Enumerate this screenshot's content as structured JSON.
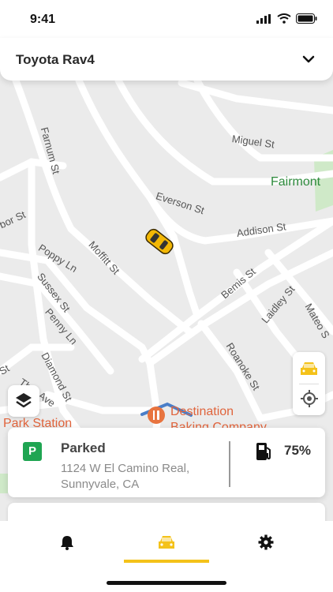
{
  "status_bar": {
    "time": "9:41"
  },
  "header": {
    "vehicle_name": "Toyota Rav4"
  },
  "map": {
    "streets": [
      {
        "label": "Farnum St"
      },
      {
        "label": "Miguel St"
      },
      {
        "label": "Everson St"
      },
      {
        "label": "Addison St"
      },
      {
        "label": "Moffitt St"
      },
      {
        "label": "Poppy Ln"
      },
      {
        "label": "Sussex St"
      },
      {
        "label": "Penny Ln"
      },
      {
        "label": "Bemis St"
      },
      {
        "label": "Laidley St"
      },
      {
        "label": "Mateo S"
      },
      {
        "label": "Roanoke St"
      },
      {
        "label": "Diamond St"
      },
      {
        "label": "Thor Ave"
      },
      {
        "label": "bor St"
      },
      {
        "label": "St"
      }
    ],
    "pois": [
      {
        "label": "Fairmont",
        "color": "#2e8b3d"
      },
      {
        "label": "Destination",
        "color": "#e0643c"
      },
      {
        "label": "Baking Company",
        "color": "#e0643c"
      },
      {
        "label": "Park Station",
        "color": "#e0643c"
      }
    ]
  },
  "status_card": {
    "badge": "P",
    "title": "Parked",
    "address": "1124 W El Camino Real, Sunnyvale, CA",
    "fuel_percent": "75%"
  },
  "tabs": [
    {
      "icon": "bell-icon",
      "active": false
    },
    {
      "icon": "car-icon",
      "active": true
    },
    {
      "icon": "gear-icon",
      "active": false
    }
  ],
  "colors": {
    "accent": "#f4c21a",
    "parked_green": "#1fa552",
    "map_bg": "#ebebeb"
  }
}
